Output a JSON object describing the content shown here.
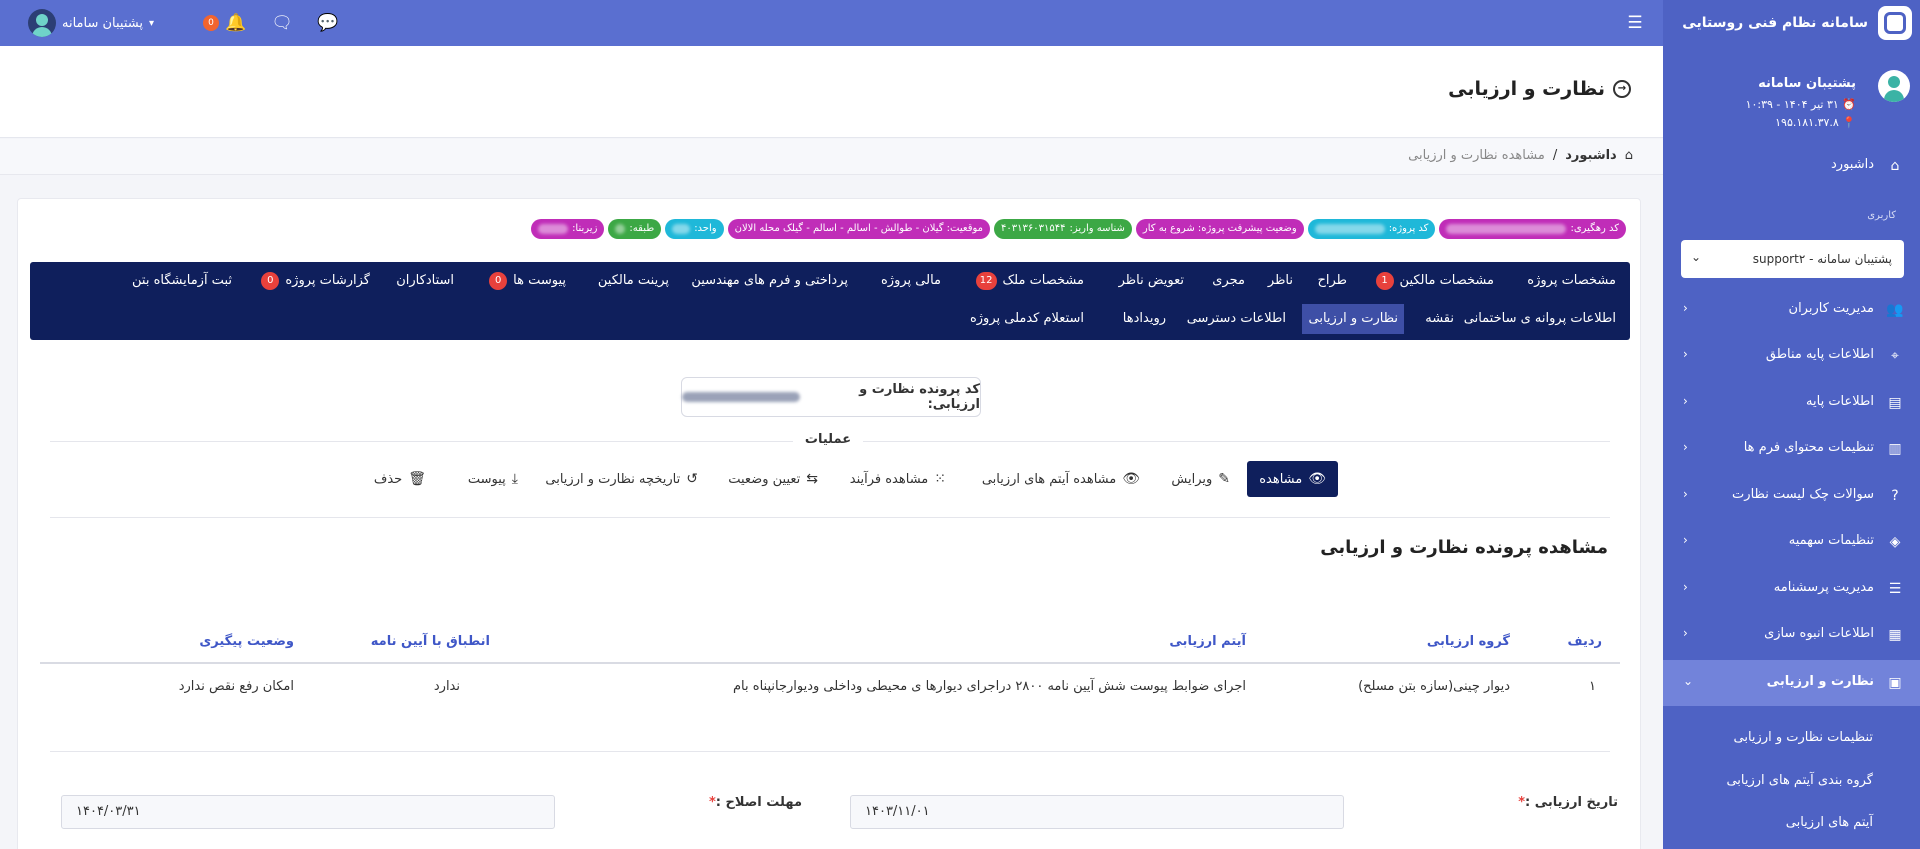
{
  "app": {
    "title": "سامانه نظام فنی روستایی"
  },
  "topbar": {
    "user_name": "پشتیبان سامانه",
    "notif_count": "0",
    "menu_icon": "hamburger-icon",
    "icons": [
      "chat-icon",
      "messages-icon",
      "bell-icon"
    ]
  },
  "sidebar": {
    "user": {
      "name": "پشتیبان سامانه",
      "datetime": "۳۱ تیر ۱۴۰۴ - ۱۰:۳۹",
      "ip": "۱۹۵.۱۸۱.۳۷.۸"
    },
    "dashboard": "داشبورد",
    "section_label": "کاربری",
    "role_select": "پشتیبان سامانه - support۲",
    "items": [
      {
        "label": "مدیریت کاربران",
        "icon": "users-icon"
      },
      {
        "label": "اطلاعات پایه مناطق",
        "icon": "map-pin-icon"
      },
      {
        "label": "اطلاعات پایه",
        "icon": "document-icon"
      },
      {
        "label": "تنظیمات محتوای فرم ها",
        "icon": "form-icon"
      },
      {
        "label": "سوالات چک لیست نظارت",
        "icon": "question-icon"
      },
      {
        "label": "تنظیمات سهمیه",
        "icon": "layers-icon"
      },
      {
        "label": "مدیریت پرسشنامه",
        "icon": "list-icon"
      },
      {
        "label": "اطلاعات انبوه سازی",
        "icon": "building-icon"
      },
      {
        "label": "نظارت و ارزیابی",
        "icon": "clipboard-icon"
      }
    ],
    "subitems": [
      "تنظیمات نظارت و ارزیابی",
      "گروه بندی آیتم های ارزیابی",
      "آیتم های ارزیابی"
    ]
  },
  "page": {
    "title": "نظارت و ارزیابی",
    "breadcrumb": {
      "home": "داشبورد",
      "sep": "/",
      "current": "مشاهده نظارت و ارزیابی"
    }
  },
  "tags": [
    {
      "label": "کد رهگیری:",
      "value": "",
      "color": "#c02db8"
    },
    {
      "label": "کد پروژه:",
      "value": "",
      "color": "#1fb8d9"
    },
    {
      "label": "وضعیت پیشرفت پروژه: شروع به کار",
      "value": "",
      "color": "#c02db8"
    },
    {
      "label": "شناسه واریز:",
      "value": "۴۰۳۱۳۶۰۳۱۵۴۴",
      "color": "#3ca845"
    },
    {
      "label": "موقعیت: گیلان - طوالش - اسالم - اسالم - گیلک محله الالان",
      "value": "",
      "color": "#c02db8"
    },
    {
      "label": "واحد:",
      "value": "",
      "color": "#1fb8d9"
    },
    {
      "label": "طبقه:",
      "value": "",
      "color": "#3ca845"
    },
    {
      "label": "زیربنا:",
      "value": "",
      "color": "#c02db8"
    }
  ],
  "tabs": {
    "row1": [
      {
        "label": "مشخصات پروژه"
      },
      {
        "label": "مشخصات مالکین",
        "badge": "1"
      },
      {
        "label": "طراح"
      },
      {
        "label": "ناظر"
      },
      {
        "label": "مجری"
      },
      {
        "label": "تعویض ناظر"
      },
      {
        "label": "مشخصات ملک",
        "badge": "12"
      },
      {
        "label": "مالی پروژه"
      },
      {
        "label": "پرداختی و فرم های مهندسین"
      },
      {
        "label": "پرینت مالکین"
      },
      {
        "label": "پیوست ها",
        "badge": "0"
      },
      {
        "label": "استادکاران"
      },
      {
        "label": "گزارشات پروژه",
        "badge": "0"
      },
      {
        "label": "ثبت آزمایشگاه بتن"
      }
    ],
    "row2": [
      {
        "label": "اطلاعات پروانه ی ساختمانی"
      },
      {
        "label": "نقشه"
      },
      {
        "label": "نظارت و ارزیابی",
        "active": true
      },
      {
        "label": "اطلاعات دسترسی"
      },
      {
        "label": "رویدادها"
      },
      {
        "label": "استعلام کدملی پروژه"
      }
    ]
  },
  "file_code": {
    "label": "کد پرونده نظارت و ارزیابی:"
  },
  "operations": {
    "title": "عملیات",
    "buttons": [
      {
        "label": "مشاهده",
        "icon": "eye-icon"
      },
      {
        "label": "ویرایش",
        "icon": "edit-icon"
      },
      {
        "label": "مشاهده آیتم های ارزیابی",
        "icon": "eye-icon"
      },
      {
        "label": "مشاهده فرآیند",
        "icon": "spinner-icon"
      },
      {
        "label": "تعیین وضعیت",
        "icon": "repeat-icon"
      },
      {
        "label": "تاریخچه نظارت و ارزیابی",
        "icon": "history-icon"
      },
      {
        "label": "پیوست",
        "icon": "download-icon"
      },
      {
        "label": "حذف",
        "icon": "trash-icon"
      }
    ]
  },
  "section": {
    "title": "مشاهده پرونده نظارت و ارزیابی"
  },
  "table": {
    "headers": [
      "ردیف",
      "گروه ارزیابی",
      "آیتم ارزیابی",
      "انطباق با آیین نامه",
      "وضعیت پیگیری"
    ],
    "rows": [
      [
        "۱",
        "دیوار چینی(سازه بتن مسلح)",
        "اجرای ضوابط پیوست شش آیین نامه ۲۸۰۰ دراجرای دیوارها ی محیطی وداخلی ودیوارجانپناه بام",
        "ندارد",
        "امکان رفع نقص ندارد"
      ]
    ]
  },
  "form": {
    "eval_date_label": "تاریخ ارزیابی :",
    "eval_date_value": "۱۴۰۳/۱۱/۰۱",
    "deadline_label": "مهلت اصلاح :",
    "deadline_value": "۱۴۰۴/۰۳/۳۱",
    "required_mark": "*"
  }
}
